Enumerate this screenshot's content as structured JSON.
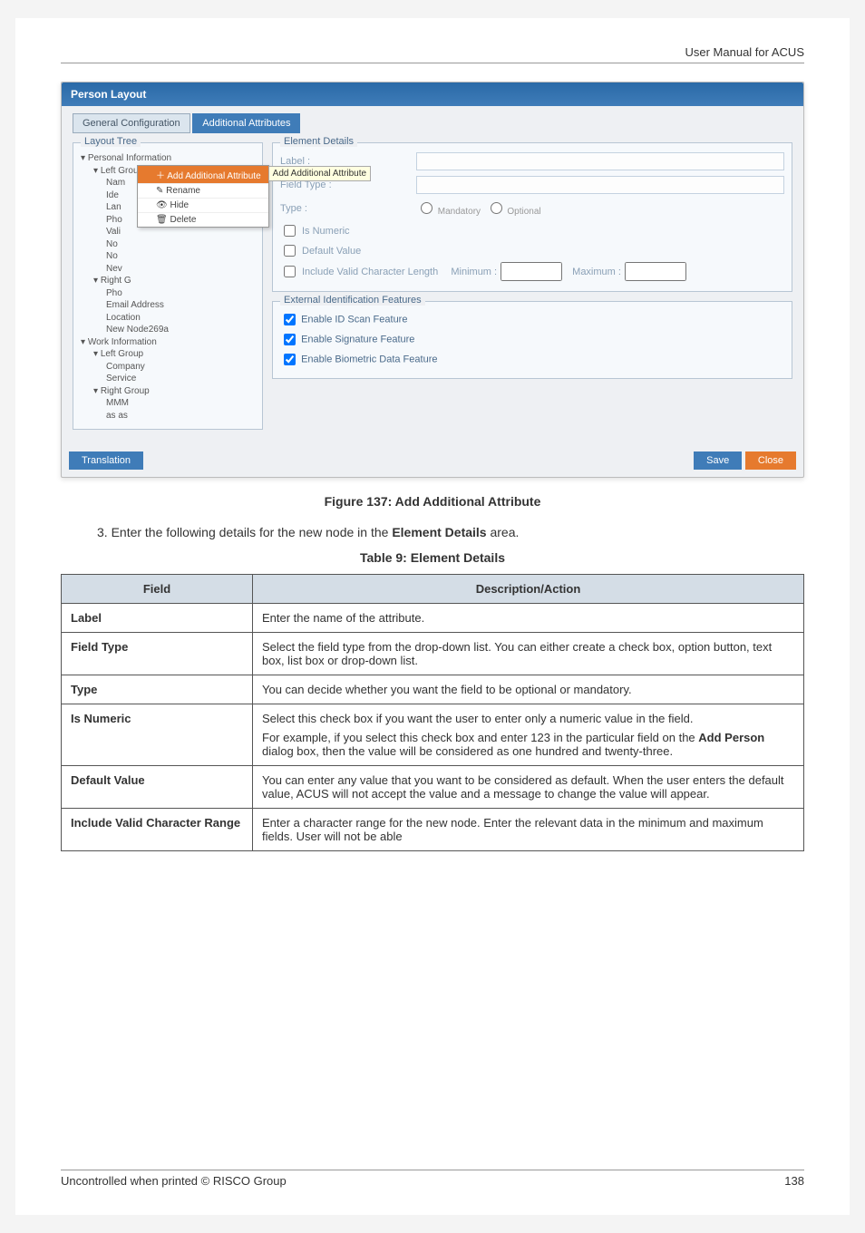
{
  "header": "User Manual for ACUS",
  "screenshot": {
    "window_title": "Person Layout",
    "tabs": {
      "general": "General Configuration",
      "additional": "Additional Attributes"
    },
    "layout_tree_title": "Layout Tree",
    "tree": {
      "personal": "Personal Information",
      "left_group": "Left Group",
      "nam": "Nam",
      "ide": "Ide",
      "lan": "Lan",
      "pho": "Pho",
      "vali": "Vali",
      "no1": "No",
      "no2": "No",
      "nev": "Nev",
      "right_g": "Right G",
      "pho2": "Pho",
      "email": "Email Address",
      "location": "Location",
      "newnode": "New Node269a",
      "work": "Work Information",
      "left_group2": "Left Group",
      "company": "Company",
      "service": "Service",
      "right_group2": "Right Group",
      "mmm": "MMM",
      "asas": "as as"
    },
    "context_menu": {
      "add": "Add Additional Attribute",
      "add_tooltip": "Add Additional Attribute",
      "rename": "Rename",
      "hide": "Hide",
      "delete": "Delete"
    },
    "element_details_title": "Element Details",
    "fields": {
      "label": "Label :",
      "field_type": "Field Type :",
      "type": "Type :",
      "mandatory": "Mandatory",
      "optional": "Optional",
      "is_numeric": "Is Numeric",
      "default_value": "Default Value",
      "include_valid": "Include Valid Character Length",
      "minimum": "Minimum :",
      "maximum": "Maximum :"
    },
    "external_title": "External Identification Features",
    "external": {
      "id_scan": "Enable ID Scan Feature",
      "signature": "Enable Signature Feature",
      "biometric": "Enable Biometric Data Feature"
    },
    "buttons": {
      "translation": "Translation",
      "save": "Save",
      "close": "Close"
    }
  },
  "figure_caption": "Figure 137: Add Additional Attribute",
  "step_text_prefix": "3.   Enter the following details for the new node in the ",
  "step_text_bold": "Element Details",
  "step_text_suffix": " area.",
  "table_title": "Table 9: Element Details",
  "table": {
    "h1": "Field",
    "h2": "Description/Action",
    "rows": [
      {
        "f": "Label",
        "d": "Enter the name of the attribute."
      },
      {
        "f": "Field Type",
        "d": "Select the field type from the drop-down list. You can either create a check box, option button, text box, list box or drop-down list."
      },
      {
        "f": "Type",
        "d": "You can decide whether you want the field to be optional or mandatory."
      },
      {
        "f": "Is Numeric",
        "d": "Select this check box if you want the user to enter only a numeric value in the field.",
        "d2a": "For example, if you select this check box and enter 123 in the particular field on the ",
        "d2b": "Add Person",
        "d2c": " dialog box, then the value will be considered as one hundred and twenty-three."
      },
      {
        "f": "Default Value",
        "d": "You can enter any value that you want to be considered as default. When the user enters the default value, ACUS will not accept the value and a message to change the value will appear."
      },
      {
        "f": "Include Valid Character Range",
        "d": "Enter a character range for the new node. Enter the relevant data in the minimum and maximum fields. User will not be able"
      }
    ]
  },
  "footer": {
    "left": "Uncontrolled when printed © RISCO Group",
    "right": "138"
  }
}
